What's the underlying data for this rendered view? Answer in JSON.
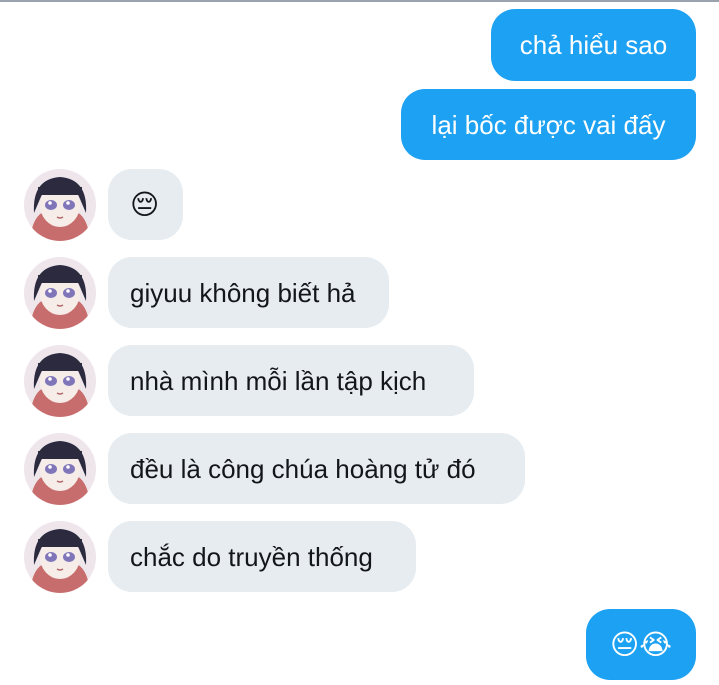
{
  "conversation": {
    "messages": [
      {
        "id": "m1",
        "direction": "outgoing",
        "text": "chả hiểu sao"
      },
      {
        "id": "m2",
        "direction": "outgoing",
        "text": "lại bốc được vai đấy"
      },
      {
        "id": "m3",
        "direction": "incoming",
        "emoji": "😔"
      },
      {
        "id": "m4",
        "direction": "incoming",
        "text": "giyuu không biết hả"
      },
      {
        "id": "m5",
        "direction": "incoming",
        "text": "nhà mình mỗi lần tập kịch"
      },
      {
        "id": "m6",
        "direction": "incoming",
        "text": "đều là công chúa hoàng tử đó"
      },
      {
        "id": "m7",
        "direction": "incoming",
        "text": "chắc do truyền thống"
      },
      {
        "id": "m8",
        "direction": "outgoing",
        "emoji": "😔😭"
      }
    ]
  },
  "avatar": {
    "icon": "anime-girl-avatar",
    "hair_color": "#2b2a3e",
    "eye_color": "#7f75b8",
    "skin_color": "#f6ede8"
  },
  "colors": {
    "outgoing_bubble": "#1da1f2",
    "incoming_bubble": "#e6ecf0",
    "outgoing_text": "#ffffff",
    "incoming_text": "#14171a"
  }
}
